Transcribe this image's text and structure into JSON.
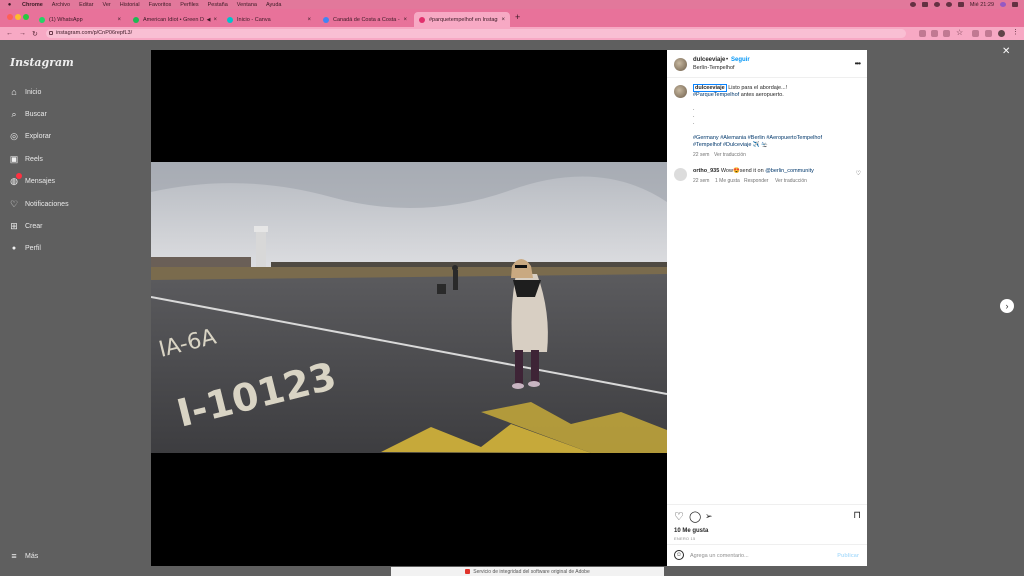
{
  "menubar": {
    "app": "Chrome",
    "items": [
      "Archivo",
      "Editar",
      "Ver",
      "Historial",
      "Favoritos",
      "Perfiles",
      "Pestaña",
      "Ventana",
      "Ayuda"
    ],
    "clock": "Mié 21:29"
  },
  "tabs": [
    {
      "title": "(1) WhatsApp",
      "favicon_color": "#25d366"
    },
    {
      "title": "American Idiot • Green Day",
      "favicon_color": "#1db954"
    },
    {
      "title": "Inicio - Canva",
      "favicon_color": "#00c4cc"
    },
    {
      "title": "Canadá de Costa a Costa - Co",
      "favicon_color": "#4285f4"
    },
    {
      "title": "#parquetempelhof en Instagr",
      "favicon_color": "#e1306c"
    }
  ],
  "address": {
    "url": "instagram.com/p/CnP06repfL3/"
  },
  "instagram": {
    "logo": "Instagram",
    "nav": [
      {
        "label": "Inicio",
        "icon": "home-icon",
        "glyph": "⌂"
      },
      {
        "label": "Buscar",
        "icon": "search-icon",
        "glyph": "⌕"
      },
      {
        "label": "Explorar",
        "icon": "compass-icon",
        "glyph": "◎"
      },
      {
        "label": "Reels",
        "icon": "reels-icon",
        "glyph": "▣"
      },
      {
        "label": "Mensajes",
        "icon": "messenger-icon",
        "glyph": "◍"
      },
      {
        "label": "Notificaciones",
        "icon": "heart-icon",
        "glyph": "♡"
      },
      {
        "label": "Crear",
        "icon": "create-icon",
        "glyph": "⊞"
      },
      {
        "label": "Perfil",
        "icon": "profile-icon",
        "glyph": "●"
      }
    ],
    "more": "Más"
  },
  "post": {
    "username": "dulceeviaje",
    "follow": "Seguir",
    "location": "Berlín-Tempelhof",
    "caption_user": "dulceeviaje",
    "caption_line1": " Listo para el abordaje...!",
    "caption_line2_tag": "#ParqueTempelhof",
    "caption_line2_rest": " antes aeropuerto.",
    "dots": ".",
    "tags_line1": "#Germany #Alemania #Berlin #AeropuertoTempelhof",
    "tags_line2": "#Tempelhof #Dulceviaje ✈️ 🛬",
    "caption_time": "22 sem",
    "see_translation": "Ver traducción",
    "comment": {
      "user": "ortho_935",
      "text": " Wow😍send it on ",
      "mention": "@berlin_community",
      "time": "22 sem",
      "likes": "1 Me gusta",
      "reply": "Responder",
      "translate": "Ver traducción"
    },
    "likes": "10 Me gusta",
    "date": "ENERO 15",
    "comment_placeholder": "Agrega un comentario...",
    "publish": "Publicar"
  },
  "adobe_bar": "Servicio de integridad del software original de Adobe"
}
